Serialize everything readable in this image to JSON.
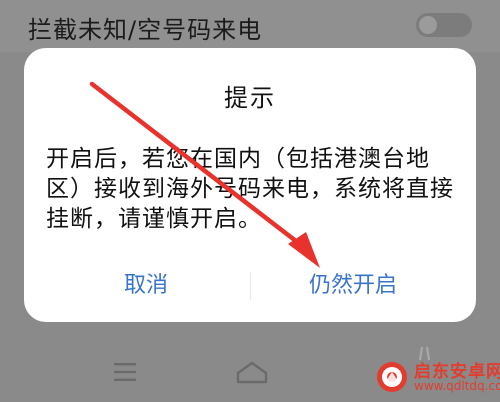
{
  "setting": {
    "label": "拦截未知/空号码来电",
    "toggle_on": false
  },
  "dialog": {
    "title": "提示",
    "message": "开启后，若您在国内（包括港澳台地区）接收到海外号码来电，系统将直接挂断，请谨慎开启。",
    "cancel_label": "取消",
    "confirm_label": "仍然开启"
  },
  "navigation": {
    "icons": [
      "menu-icon",
      "home-icon",
      "back-icon"
    ]
  },
  "annotation": {
    "arrow_color": "#e8322b"
  },
  "watermark": {
    "title": "启东安卓网",
    "url": "www.qdltdq.com"
  },
  "colors": {
    "accent": "#3a74c9",
    "overlay": "#8a8a8a",
    "dialog_bg": "#ffffff"
  }
}
